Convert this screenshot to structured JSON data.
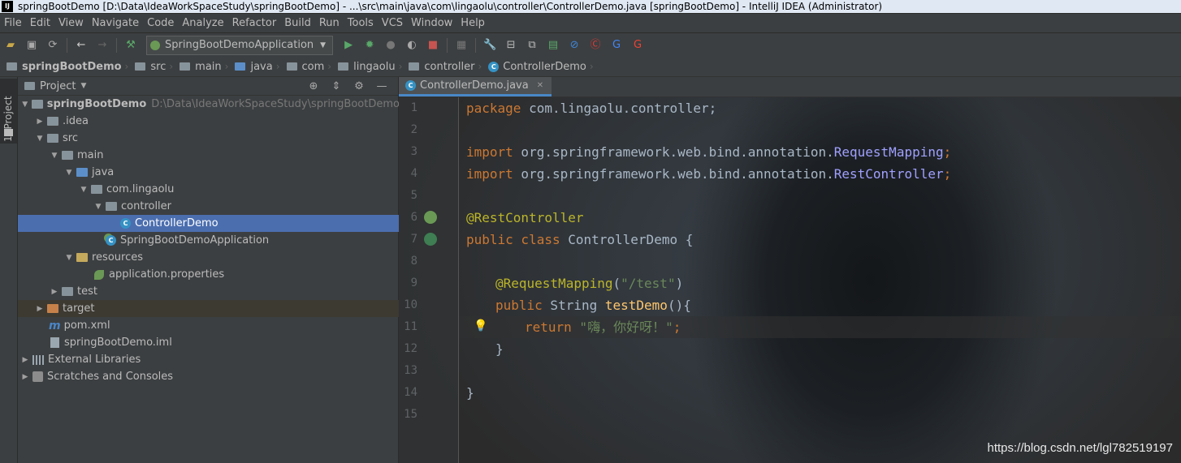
{
  "window": {
    "title": "springBootDemo [D:\\Data\\IdeaWorkSpaceStudy\\springBootDemo] - ...\\src\\main\\java\\com\\lingaolu\\controller\\ControllerDemo.java [springBootDemo] - IntelliJ IDEA (Administrator)",
    "app_icon_text": "IJ"
  },
  "menu": [
    "File",
    "Edit",
    "View",
    "Navigate",
    "Code",
    "Analyze",
    "Refactor",
    "Build",
    "Run",
    "Tools",
    "VCS",
    "Window",
    "Help"
  ],
  "toolbar": {
    "run_config": "SpringBootDemoApplication",
    "icons": [
      "open-icon",
      "save-icon",
      "sync-icon",
      "back-icon",
      "forward-icon",
      "build-icon",
      "run-icon",
      "debug-icon",
      "coverage-icon",
      "profile-icon",
      "stop-icon",
      "project-structure-icon",
      "settings-icon",
      "sdk-icon",
      "terminal-icon",
      "jrebel-icon",
      "translate-icon",
      "google-translate-icon"
    ]
  },
  "breadcrumbs": [
    "springBootDemo",
    "src",
    "main",
    "java",
    "com",
    "lingaolu",
    "controller",
    "ControllerDemo"
  ],
  "side_strip": {
    "tab_label": "1: Project"
  },
  "project": {
    "header_title": "Project",
    "tree": [
      {
        "label": "springBootDemo",
        "path": "D:\\Data\\IdeaWorkSpaceStudy\\springBootDemo",
        "depth": 0,
        "expanded": true,
        "icon": "module-folder"
      },
      {
        "label": ".idea",
        "depth": 1,
        "expanded": false,
        "icon": "folder"
      },
      {
        "label": "src",
        "depth": 1,
        "expanded": true,
        "icon": "folder"
      },
      {
        "label": "main",
        "depth": 2,
        "expanded": true,
        "icon": "folder"
      },
      {
        "label": "java",
        "depth": 3,
        "expanded": true,
        "icon": "source-folder"
      },
      {
        "label": "com.lingaolu",
        "depth": 4,
        "expanded": true,
        "icon": "package"
      },
      {
        "label": "controller",
        "depth": 5,
        "expanded": true,
        "icon": "package"
      },
      {
        "label": "ControllerDemo",
        "depth": 6,
        "selected": true,
        "icon": "class"
      },
      {
        "label": "SpringBootDemoApplication",
        "depth": 5,
        "icon": "spring-class"
      },
      {
        "label": "resources",
        "depth": 3,
        "expanded": true,
        "icon": "resources-folder"
      },
      {
        "label": "application.properties",
        "depth": 4,
        "icon": "spring-properties"
      },
      {
        "label": "test",
        "depth": 2,
        "expanded": false,
        "icon": "folder"
      },
      {
        "label": "target",
        "depth": 1,
        "expanded": false,
        "icon": "excluded-folder"
      },
      {
        "label": "pom.xml",
        "depth": 1,
        "icon": "maven"
      },
      {
        "label": "springBootDemo.iml",
        "depth": 1,
        "icon": "file"
      },
      {
        "label": "External Libraries",
        "depth": 0,
        "expanded": false,
        "icon": "libraries"
      },
      {
        "label": "Scratches and Consoles",
        "depth": 0,
        "expanded": false,
        "icon": "scratches"
      }
    ]
  },
  "editor": {
    "tab": "ControllerDemo.java",
    "line_numbers": [
      "1",
      "2",
      "3",
      "4",
      "5",
      "6",
      "7",
      "8",
      "9",
      "10",
      "11",
      "12",
      "13",
      "14",
      "15"
    ],
    "lines": {
      "l1_kw": "package",
      "l1_rest": " com.lingaolu.controller;",
      "l3_kw": "import",
      "l3_pkg": " org.springframework.web.bind.annotation.",
      "l3_cls": "RequestMapping",
      "l3_end": ";",
      "l4_kw": "import",
      "l4_pkg": " org.springframework.web.bind.annotation.",
      "l4_cls": "RestController",
      "l4_end": ";",
      "l6_ann": "@RestController",
      "l7_kw": "public class",
      "l7_name": " ControllerDemo",
      "l7_end": " {",
      "l9_ann": "@RequestMapping",
      "l9_open": "(",
      "l9_str": "\"/test\"",
      "l9_close": ")",
      "l10_kw": "public",
      "l10_type": " String",
      "l10_fn": " testDemo",
      "l10_end": "(){",
      "l11_kw": "return",
      "l11_str": " \"嗨，你好呀！\"",
      "l11_end": ";",
      "l12": "}",
      "l14": "}"
    }
  },
  "watermark": "https://blog.csdn.net/lgl782519197"
}
